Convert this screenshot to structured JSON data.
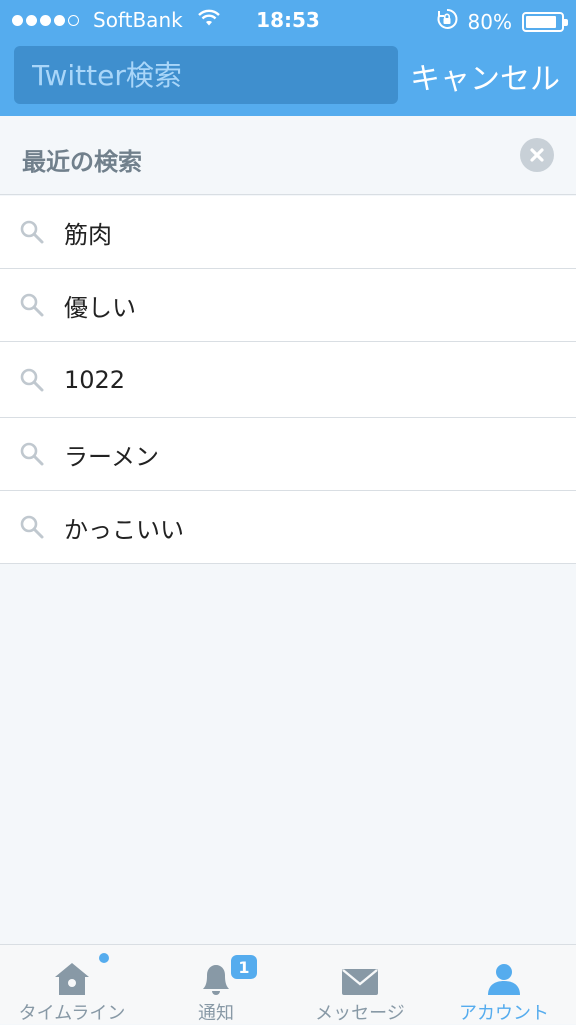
{
  "status_bar": {
    "carrier": "SoftBank",
    "time": "18:53",
    "battery": "80%",
    "signal_bars": 4,
    "signal_total": 5
  },
  "search": {
    "placeholder": "Twitter検索",
    "value": "",
    "cancel_label": "キャンセル"
  },
  "recent": {
    "title": "最近の検索",
    "items": [
      {
        "label": "筋肉"
      },
      {
        "label": "優しい"
      },
      {
        "label": "1022"
      },
      {
        "label": "ラーメン"
      },
      {
        "label": "かっこいい"
      }
    ]
  },
  "tabs": [
    {
      "label": "タイムライン",
      "icon": "home-icon"
    },
    {
      "label": "通知",
      "icon": "bell-icon",
      "badge": "1"
    },
    {
      "label": "メッセージ",
      "icon": "envelope-icon"
    },
    {
      "label": "アカウント",
      "icon": "person-icon"
    }
  ],
  "colors": {
    "brand": "#55acee",
    "search_field": "#3f8fce",
    "tab_inactive": "#8899a6"
  }
}
